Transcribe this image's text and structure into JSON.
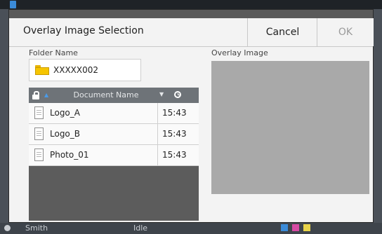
{
  "background": {
    "status_user": "Smith",
    "status_state": "Idle"
  },
  "dialog": {
    "title": "Overlay Image Selection",
    "cancel_label": "Cancel",
    "ok_label": "OK",
    "folder_label": "Folder Name",
    "folder_value": "XXXXX002",
    "overlay_label": "Overlay Image",
    "table": {
      "column_name": "Document Name",
      "rows": [
        {
          "name": "Logo_A",
          "time": "15:43"
        },
        {
          "name": "Logo_B",
          "time": "15:43"
        },
        {
          "name": "Photo_01",
          "time": "15:43"
        }
      ]
    }
  },
  "colors": {
    "accent": "#4a9be8",
    "folder": "#f6c500",
    "disabled": "#9a9a9a",
    "preview": "#a9a9a9"
  },
  "icons": [
    "lock-icon",
    "sort-ascending-icon",
    "sort-descending-icon",
    "clock-icon",
    "folder-icon",
    "document-icon"
  ]
}
